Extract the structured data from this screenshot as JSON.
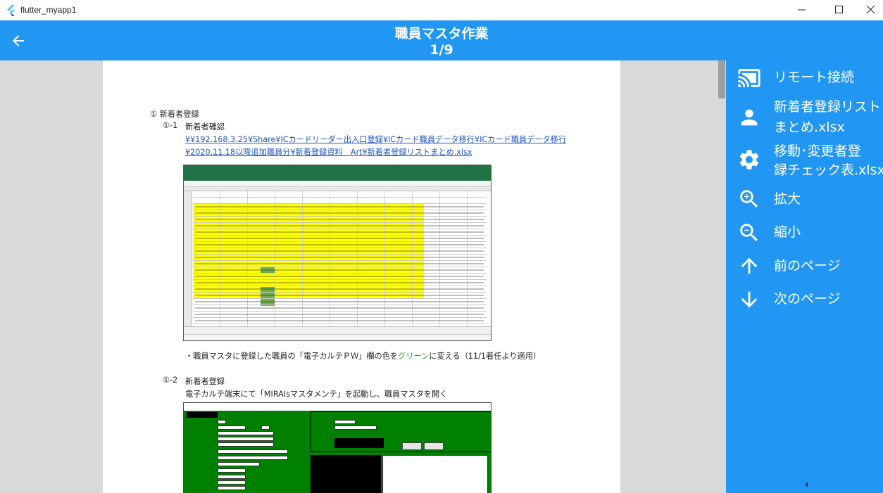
{
  "window": {
    "title": "flutter_myapp1",
    "minimize_icon": "minimize-icon",
    "maximize_icon": "maximize-icon",
    "close_icon": "close-icon"
  },
  "appbar": {
    "title": "職員マスタ作業",
    "page_indicator": "1/9",
    "back_icon": "arrow-left-icon",
    "color": "#2196f3"
  },
  "document": {
    "heading1": "①  新着者登録",
    "sub1_number": "①-1",
    "sub1_title": "新着者確認",
    "path_line1": "¥¥192.168.3.25¥Share¥ICカードリーダー出入口登録¥ICカード職員データ移行¥ICカード職員データ移行",
    "path_line2": "¥2020.11.18以降追加職員分¥新着登録資料　Art¥新着者登録リストまとめ.xlsx",
    "note_prefix": "・職員マスタに登録した職員の「電子カルテＰＷ」欄の色を",
    "note_green": "グリーン",
    "note_suffix": "に変える（11/1着任より適用）",
    "sub2_number": "①-2",
    "sub2_title": "新着者登録",
    "sub2_desc": "電子カルテ端末にて「MIRAIsマスタメンテ」を起動し、職員マスタを開く",
    "link_color": "#1f55c6",
    "green_color": "#2ca02c"
  },
  "sidebar": {
    "items": [
      {
        "label": "リモート接続",
        "icon": "cast-icon"
      },
      {
        "label": "新着者登録リスト",
        "label2": "まとめ.xlsx",
        "icon": "person-icon"
      },
      {
        "label": "移動･変更者登",
        "label2": "録チェック表.xlsx",
        "icon": "gear-icon"
      },
      {
        "label": "拡大",
        "icon": "zoom-in-icon"
      },
      {
        "label": "縮小",
        "icon": "zoom-out-icon"
      },
      {
        "label": "前のページ",
        "icon": "arrow-up-icon"
      },
      {
        "label": "次のページ",
        "icon": "arrow-down-icon"
      }
    ],
    "collapse_icon": "caret-left-icon"
  }
}
